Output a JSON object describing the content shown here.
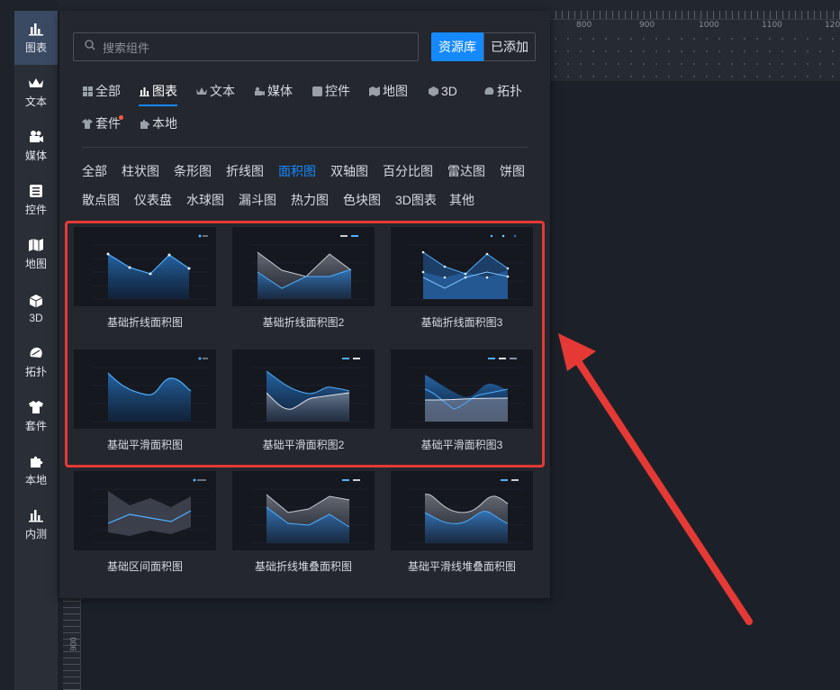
{
  "sidebar": {
    "items": [
      {
        "label": "图表",
        "icon": "bar-chart-icon"
      },
      {
        "label": "文本",
        "icon": "crown-text-icon"
      },
      {
        "label": "媒体",
        "icon": "video-camera-icon"
      },
      {
        "label": "控件",
        "icon": "widget-list-icon"
      },
      {
        "label": "地图",
        "icon": "map-icon"
      },
      {
        "label": "3D",
        "icon": "cube-icon"
      },
      {
        "label": "拓扑",
        "icon": "topology-icon"
      },
      {
        "label": "套件",
        "icon": "shirt-kit-icon"
      },
      {
        "label": "本地",
        "icon": "puzzle-icon"
      },
      {
        "label": "内测",
        "icon": "beta-chart-icon"
      }
    ]
  },
  "search": {
    "placeholder": "搜索组件"
  },
  "source": {
    "library": "资源库",
    "added": "已添加"
  },
  "categories": [
    "全部",
    "图表",
    "文本",
    "媒体",
    "控件",
    "地图",
    "3D",
    "拓扑",
    "套件",
    "本地"
  ],
  "subcategories": [
    "全部",
    "柱状图",
    "条形图",
    "折线图",
    "面积图",
    "双轴图",
    "百分比图",
    "雷达图",
    "饼图",
    "散点图",
    "仪表盘",
    "水球图",
    "漏斗图",
    "热力图",
    "色块图",
    "3D图表",
    "其他"
  ],
  "cards": [
    {
      "label": "基础折线面积图"
    },
    {
      "label": "基础折线面积图2"
    },
    {
      "label": "基础折线面积图3"
    },
    {
      "label": "基础平滑面积图"
    },
    {
      "label": "基础平滑面积图2"
    },
    {
      "label": "基础平滑面积图3"
    },
    {
      "label": "基础区间面积图"
    },
    {
      "label": "基础折线堆叠面积图"
    },
    {
      "label": "基础平滑线堆叠面积图"
    }
  ],
  "ruler": {
    "top": [
      "800",
      "900",
      "1000",
      "1100",
      "120"
    ],
    "left": "900"
  },
  "colors": {
    "accent": "#1589ff",
    "highlight": "#e53935",
    "panel": "#24272e"
  }
}
